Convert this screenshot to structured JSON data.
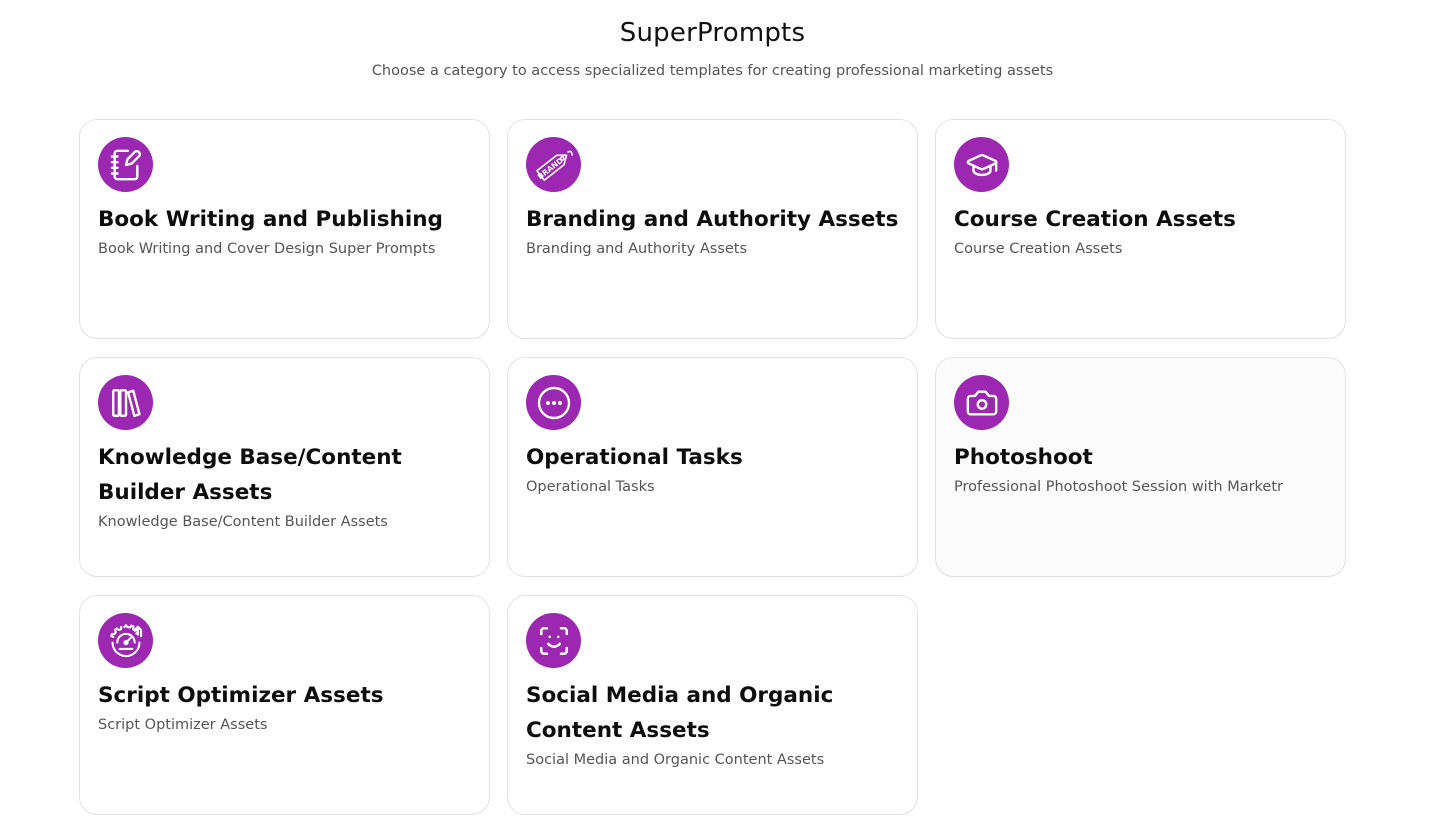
{
  "header": {
    "title": "SuperPrompts",
    "subtitle": "Choose a category to access specialized templates for creating professional marketing assets"
  },
  "colors": {
    "accent": "#9c27b0"
  },
  "categories": [
    {
      "title": "Book Writing and Publishing",
      "description": "Book Writing and Cover Design Super Prompts",
      "icon": "notebook-pen-icon"
    },
    {
      "title": "Branding and Authority Assets",
      "description": "Branding and Authority Assets",
      "icon": "brand-tag-icon",
      "icon_text": "BRAND"
    },
    {
      "title": "Course Creation Assets",
      "description": "Course Creation Assets",
      "icon": "graduation-cap-icon"
    },
    {
      "title": "Knowledge Base/Content Builder Assets",
      "description": "Knowledge Base/Content Builder Assets",
      "icon": "library-icon"
    },
    {
      "title": "Operational Tasks",
      "description": "Operational Tasks",
      "icon": "circle-ellipsis-icon"
    },
    {
      "title": "Photoshoot",
      "description": "Professional Photoshoot Session with Marketr",
      "icon": "camera-icon"
    },
    {
      "title": "Script Optimizer Assets",
      "description": "Script Optimizer Assets",
      "icon": "gear-gauge-icon"
    },
    {
      "title": "Social Media and Organic Content Assets",
      "description": "Social Media and Organic Content Assets",
      "icon": "face-scan-icon"
    }
  ]
}
